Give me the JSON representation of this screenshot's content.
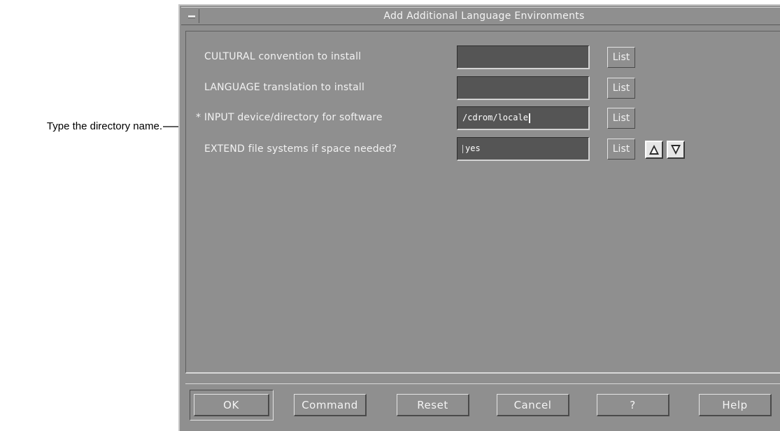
{
  "callout": {
    "text": "Type the directory name."
  },
  "window": {
    "title": "Add Additional Language Environments"
  },
  "form": {
    "rows": [
      {
        "label": "CULTURAL convention to install",
        "value": "",
        "list_label": "List"
      },
      {
        "label": "LANGUAGE translation to install",
        "value": "",
        "list_label": "List"
      },
      {
        "label": "* INPUT device/directory for software",
        "value": "/cdrom/locale",
        "list_label": "List"
      },
      {
        "label": "EXTEND file systems if space needed?",
        "value": "yes",
        "list_label": "List"
      }
    ],
    "toggle_icons": {
      "up": "triangle-up-icon",
      "down": "triangle-down-icon"
    }
  },
  "buttons": {
    "ok": "OK",
    "command": "Command",
    "reset": "Reset",
    "cancel": "Cancel",
    "question": "?",
    "help": "Help"
  },
  "colors": {
    "window_bg": "#8f8f8f",
    "field_bg": "#555555",
    "text": "#f2f2f2"
  }
}
